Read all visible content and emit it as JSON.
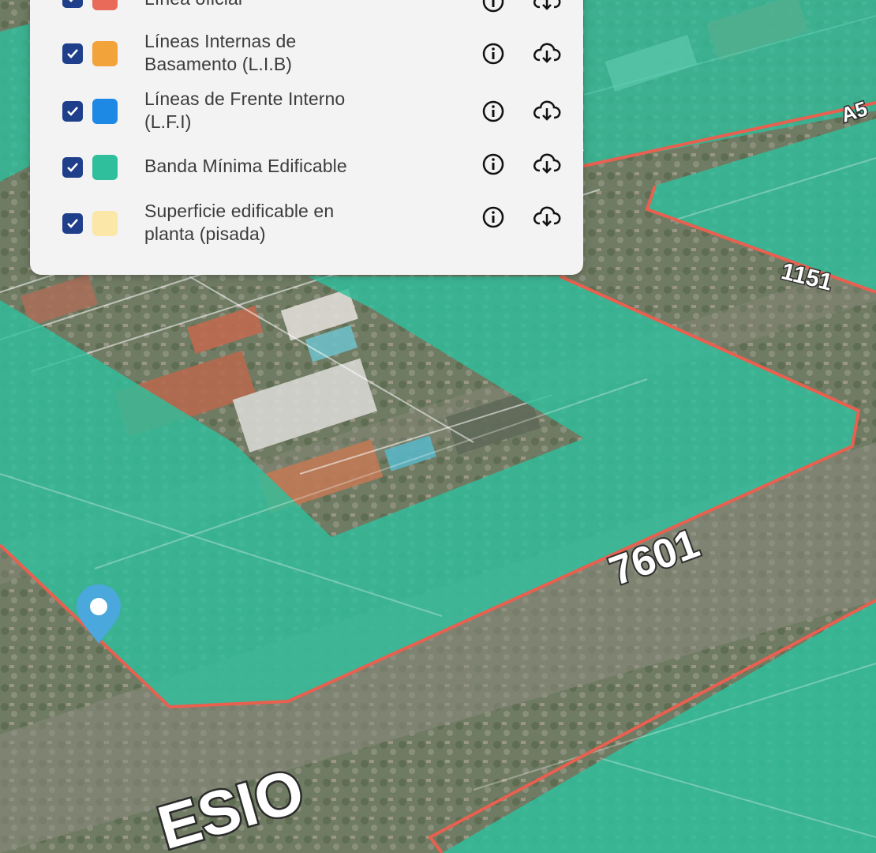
{
  "map": {
    "street_label_1": "7601",
    "street_label_2": "1151",
    "road_label_partial": "ESIO",
    "block_label_partial": "A5",
    "colors": {
      "zone_fill": "#2fbf9c",
      "boundary": "#e8604f",
      "marker": "#4aa8dc"
    }
  },
  "legend": {
    "layers": [
      {
        "label_line1": "Línea oficial",
        "label_line2": "",
        "checked": true,
        "color": "#ea6a5a",
        "info_icon": "info-icon",
        "download_icon": "cloud-download-icon"
      },
      {
        "label_line1": "Líneas Internas de",
        "label_line2": "Basamento (L.I.B)",
        "checked": true,
        "color": "#f2a33a",
        "info_icon": "info-icon",
        "download_icon": "cloud-download-icon"
      },
      {
        "label_line1": "Líneas de Frente Interno",
        "label_line2": "(L.F.I)",
        "checked": true,
        "color": "#1e88e5",
        "info_icon": "info-icon",
        "download_icon": "cloud-download-icon"
      },
      {
        "label_line1": "Banda Mínima Edificable",
        "label_line2": "",
        "checked": true,
        "color": "#2fbf9c",
        "info_icon": "info-icon",
        "download_icon": "cloud-download-icon"
      },
      {
        "label_line1": "Superficie edificable en",
        "label_line2": "planta (pisada)",
        "checked": true,
        "color": "#fbe7a8",
        "info_icon": "info-icon",
        "download_icon": "cloud-download-icon"
      }
    ]
  }
}
